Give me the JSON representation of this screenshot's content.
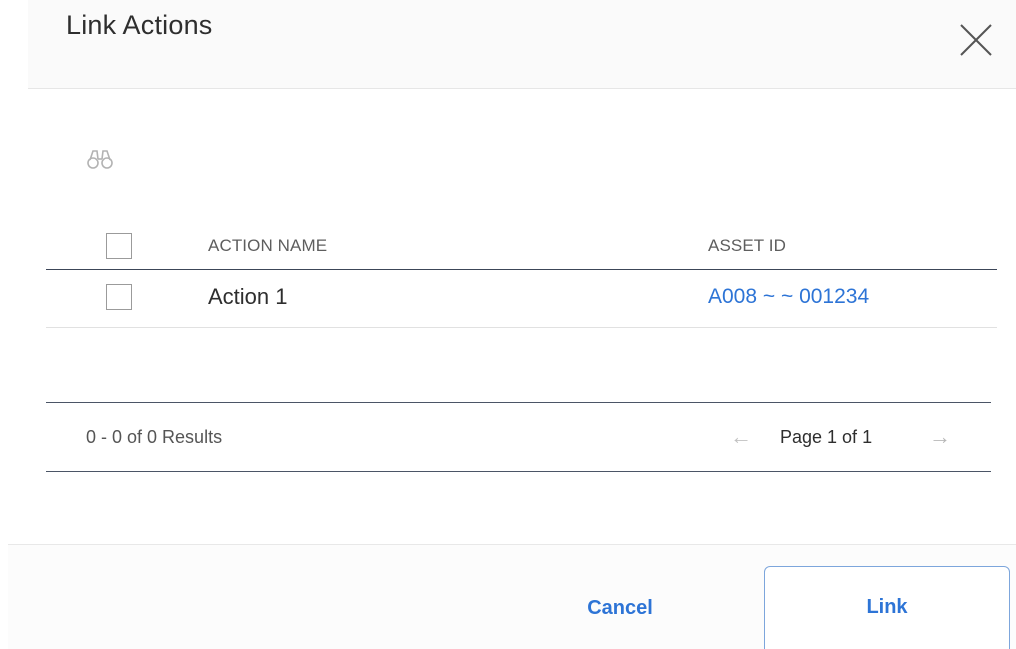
{
  "dialog": {
    "title": "Link Actions",
    "close_icon": "close-icon",
    "search_icon": "binoculars-icon"
  },
  "table": {
    "columns": [
      "ACTION NAME",
      "ASSET ID"
    ],
    "rows": [
      {
        "action_name": "Action 1",
        "asset_id": "A008 ~ ~ 001234",
        "checked": false
      }
    ],
    "select_all_checked": false
  },
  "pager": {
    "results": "0 - 0 of 0 Results",
    "page_label": "Page 1 of 1",
    "prev_icon": "arrow-left-icon",
    "next_icon": "arrow-right-icon",
    "prev_arrow": "←",
    "next_arrow": "→"
  },
  "footer": {
    "cancel_label": "Cancel",
    "link_label": "Link"
  },
  "colors": {
    "accent": "#2d74d6",
    "header_bg": "#fafafa",
    "rule": "#3c4658"
  }
}
